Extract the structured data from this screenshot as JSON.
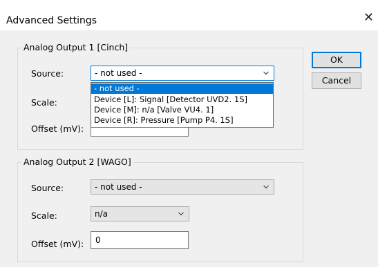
{
  "dialog": {
    "title": "Advanced Settings",
    "close_glyph": "✕"
  },
  "buttons": {
    "ok": "OK",
    "cancel": "Cancel"
  },
  "group1": {
    "legend": "Analog Output 1 [Cinch]",
    "source_label": "Source:",
    "source_value": "- not used -",
    "scale_label": "Scale:",
    "offset_label": "Offset (mV):",
    "dropdown_options": [
      "- not used -",
      "Device [L]: Signal [Detector UVD2. 1S]",
      "Device [M]: n/a [Valve VU4. 1]",
      "Device [R]: Pressure [Pump P4. 1S]"
    ],
    "selected_index": 0
  },
  "group2": {
    "legend": "Analog Output 2 [WAGO]",
    "source_label": "Source:",
    "source_value": "- not used -",
    "scale_label": "Scale:",
    "scale_value": "n/a",
    "offset_label": "Offset (mV):",
    "offset_value": "0"
  },
  "icons": {
    "close": "close-icon",
    "chevron": "chevron-down-icon"
  },
  "colors": {
    "accent": "#0078d7",
    "selection_text": "#ffffff"
  }
}
